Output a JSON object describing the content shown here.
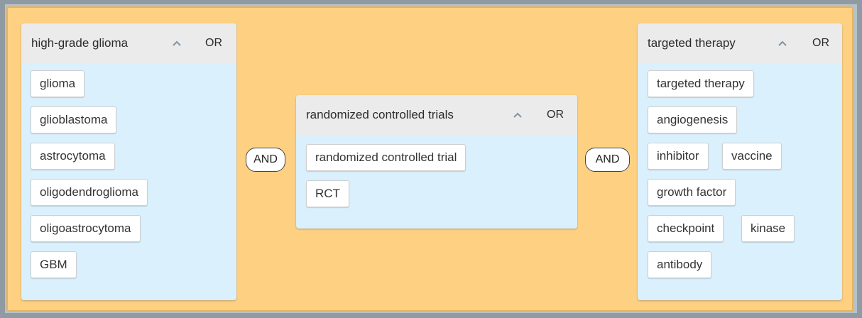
{
  "groups": [
    {
      "title": "high-grade glioma",
      "operator": "OR",
      "chevron_icon": "chevron-up-icon",
      "terms": [
        "glioma",
        "glioblastoma",
        "astrocytoma",
        "oligodendroglioma",
        "oligoastrocytoma",
        "GBM"
      ]
    },
    {
      "title": "randomized controlled trials",
      "operator": "OR",
      "chevron_icon": "chevron-up-icon",
      "terms": [
        "randomized controlled trial",
        "RCT"
      ]
    },
    {
      "title": "targeted therapy",
      "operator": "OR",
      "chevron_icon": "chevron-up-icon",
      "terms": [
        "targeted therapy",
        "angiogenesis",
        "inhibitor",
        "vaccine",
        "growth factor",
        "checkpoint",
        "kinase",
        "antibody"
      ]
    }
  ],
  "connectors": [
    "AND",
    "AND"
  ],
  "colors": {
    "canvas": "#fdd082",
    "group_body": "#daf0fc",
    "group_header": "#ebebeb",
    "chevron": "#7f93a3"
  }
}
